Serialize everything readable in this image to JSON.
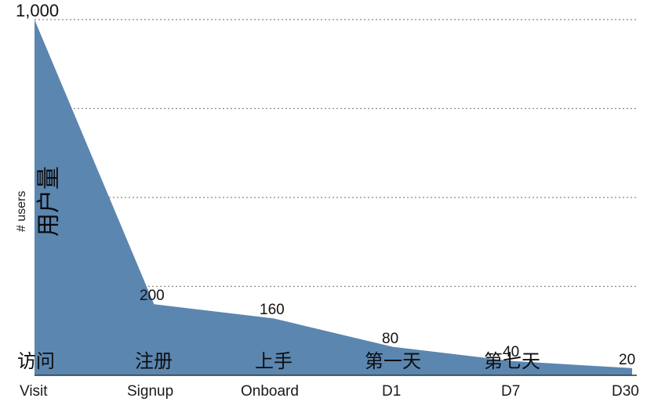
{
  "chart_data": {
    "type": "area",
    "title": "",
    "subtitle": "",
    "xlabel": "",
    "ylabel": "# users",
    "series_label": "用户量",
    "categories": [
      "Visit",
      "Signup",
      "Onboard",
      "D1",
      "D7",
      "D30"
    ],
    "categories_zh": [
      "访问",
      "注册",
      "上手",
      "第一天",
      "第七天",
      ""
    ],
    "values": [
      1000,
      200,
      160,
      80,
      40,
      20
    ],
    "value_labels": [
      "1,000",
      "200",
      "160",
      "80",
      "40",
      "20"
    ],
    "ylim": [
      0,
      1000
    ],
    "gridlines": [
      1000,
      750,
      500,
      250
    ],
    "grid": true,
    "legend": "none",
    "colors": {
      "area_fill": "#5b86b0",
      "gridline": "#888888",
      "axis": "#444444",
      "text": "#111111"
    }
  },
  "axis": {
    "y_title": "# users",
    "top_tick_label": "1,000"
  },
  "series": {
    "name_zh": "用户量"
  }
}
